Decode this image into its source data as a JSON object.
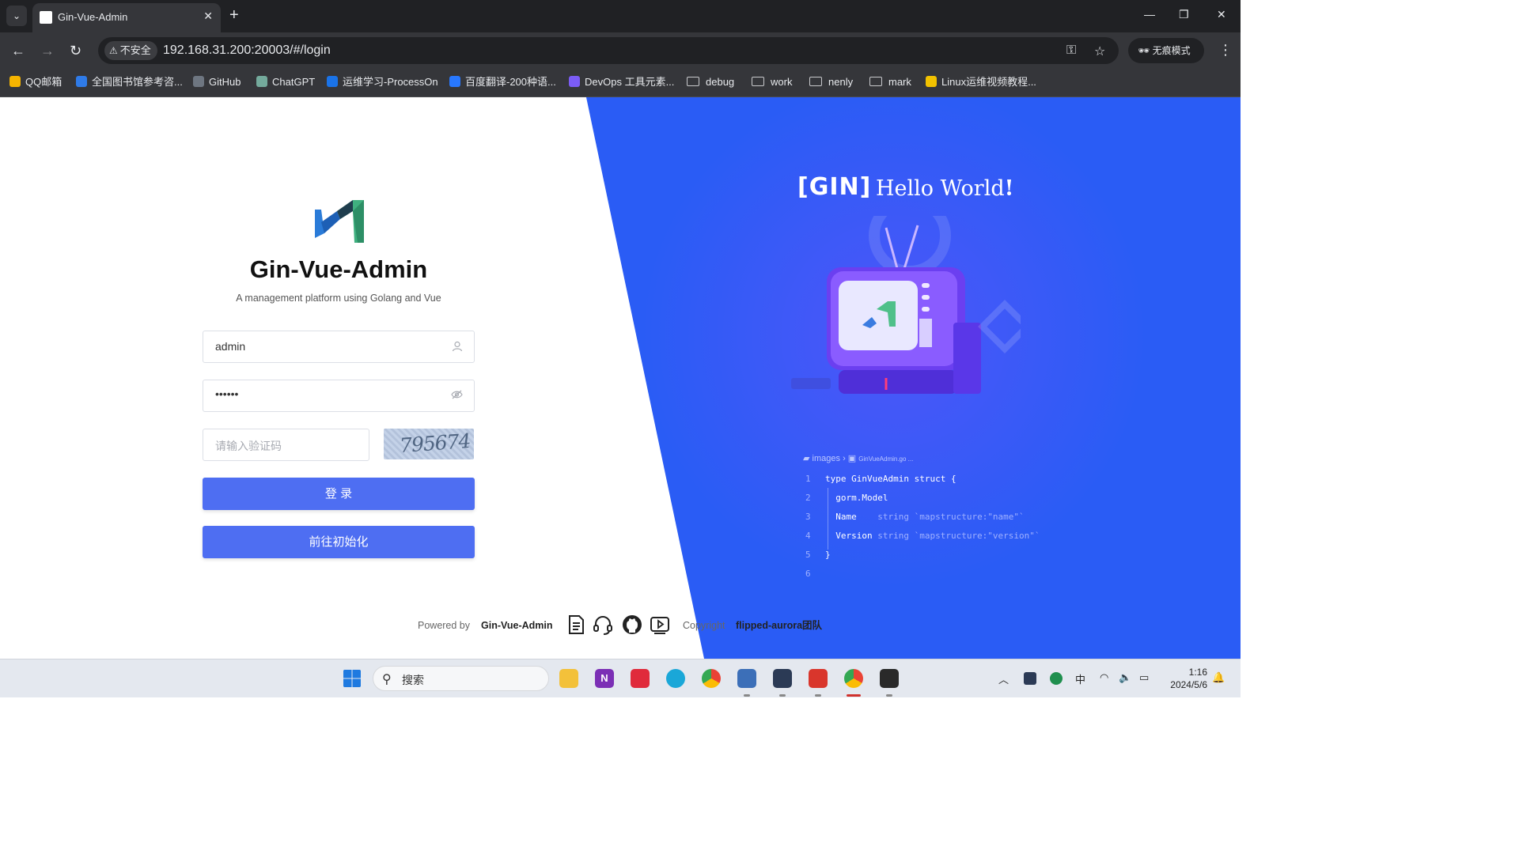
{
  "browser": {
    "tab_title": "Gin-Vue-Admin",
    "insecure_label": "不安全",
    "url": "192.168.31.200:20003/#/login",
    "incognito_label": "无痕模式"
  },
  "bookmarks": [
    {
      "label": "QQ邮箱",
      "kind": "site",
      "color": "#f5b400"
    },
    {
      "label": "全国图书馆参考咨...",
      "kind": "site",
      "color": "#2f7be8"
    },
    {
      "label": "GitHub",
      "kind": "site",
      "color": "#6e7681"
    },
    {
      "label": "ChatGPT",
      "kind": "site",
      "color": "#74aa9c"
    },
    {
      "label": "运维学习-ProcessOn",
      "kind": "site",
      "color": "#1a73e8"
    },
    {
      "label": "百度翻译-200种语...",
      "kind": "site",
      "color": "#2878ff"
    },
    {
      "label": "DevOps 工具元素...",
      "kind": "site",
      "color": "#7b5cf5"
    },
    {
      "label": "debug",
      "kind": "folder"
    },
    {
      "label": "work",
      "kind": "folder"
    },
    {
      "label": "nenly",
      "kind": "folder"
    },
    {
      "label": "mark",
      "kind": "folder"
    },
    {
      "label": "Linux运维视频教程...",
      "kind": "site",
      "color": "#f2c200"
    }
  ],
  "login": {
    "title": "Gin-Vue-Admin",
    "subtitle": "A management platform using Golang and Vue",
    "username_value": "admin",
    "password_value": "••••••",
    "captcha_placeholder": "请输入验证码",
    "captcha_text": "795674",
    "login_button": "登 录",
    "init_button": "前往初始化"
  },
  "footer": {
    "powered_by": "Powered by",
    "powered_name": "Gin-Vue-Admin",
    "copyright": "Copyright",
    "team": "flipped-aurora团队"
  },
  "hero": {
    "gin_label": "[GIN]",
    "hello": "Hello World",
    "breadcrumb_folder": "images",
    "breadcrumb_file": "GinVueAdmin.go ...",
    "code": [
      {
        "n": "1",
        "text": "type GinVueAdmin struct {"
      },
      {
        "n": "2",
        "text": "  gorm.Model"
      },
      {
        "n": "3",
        "text": "  Name",
        "dim": "    string `mapstructure:\"name\"`"
      },
      {
        "n": "4",
        "text": "  Version",
        "dim": " string `mapstructure:\"version\"`"
      },
      {
        "n": "5",
        "text": "}"
      },
      {
        "n": "6",
        "text": ""
      }
    ]
  },
  "taskbar": {
    "search_label": "搜索",
    "ime": "中",
    "time": "1:16",
    "date": "2024/5/6"
  },
  "colors": {
    "accent_button": "#4e6ef2",
    "hero_blue": "#2a5cf5"
  }
}
